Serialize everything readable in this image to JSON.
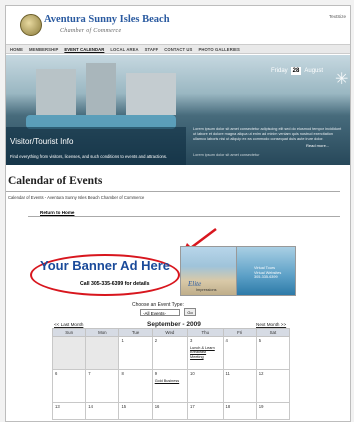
{
  "header": {
    "logo_title": "Aventura Sunny Isles Beach",
    "logo_subtitle": "Chamber of Commerce",
    "text_size_label": "TextSize"
  },
  "nav": [
    {
      "label": "HOME",
      "active": false
    },
    {
      "label": "MEMBERSHIP",
      "active": false
    },
    {
      "label": "EVENT CALENDAR",
      "active": true
    },
    {
      "label": "LOCAL AREA",
      "active": false
    },
    {
      "label": "STAFF",
      "active": false
    },
    {
      "label": "CONTACT US",
      "active": false
    },
    {
      "label": "PHOTO GALLERIES",
      "active": false
    }
  ],
  "hero": {
    "title": "Visitor/Tourist Info",
    "subtitle": "Find everything from visitors, licenses, and such conditions to events and attractions.",
    "day_name": "Friday",
    "day_number": "28",
    "month": "August",
    "news_text": "Lorem ipsum dolor sit amet consectetur adipiscing elit sed do eiusmod tempor incididunt ut labore et dolore magna aliqua ut enim ad minim veniam quis nostrud exercitation ullamco laboris nisi ut aliquip ex ea commodo consequat duis aute irure dolor.",
    "read_more": "Read more...",
    "news_footer": "Lorem ipsum dolor sit amet consectetur"
  },
  "page": {
    "heading": "Calendar of Events",
    "breadcrumb": "Calendar of Events - Aventura Sunny Isles Beach Chamber of Commerce",
    "back_link": "Return to Home"
  },
  "banner_ad": {
    "title": "Your Banner Ad Here",
    "subtitle": "Call 305-335-6399 for details",
    "outline_color": "#d8161e",
    "arrow_color": "#d8161e"
  },
  "side_ad": {
    "brand": "Elite",
    "brand_sub": "Impressions",
    "tours_text": "Virtual Tours\nVirtual Websites\n305-335-6399"
  },
  "event_filter": {
    "label": "Choose an Event Type:",
    "selected": "-All Events-",
    "button": "Go"
  },
  "calendar": {
    "prev_label": "<< Last Month",
    "next_label": "Next Month >>",
    "title": "September - 2009",
    "weekdays": [
      "Sun",
      "Mon",
      "Tue",
      "Wed",
      "Thu",
      "Fri",
      "Sat"
    ],
    "weeks": [
      [
        {
          "day": "",
          "empty": true
        },
        {
          "day": "",
          "empty": true
        },
        {
          "day": "1"
        },
        {
          "day": "2"
        },
        {
          "day": "3",
          "event": "Lunch & Learn Breakfast Meeting"
        },
        {
          "day": "4"
        },
        {
          "day": "5"
        }
      ],
      [
        {
          "day": "6"
        },
        {
          "day": "7"
        },
        {
          "day": "8"
        },
        {
          "day": "9",
          "event": "Gold Business"
        },
        {
          "day": "10"
        },
        {
          "day": "11"
        },
        {
          "day": "12"
        }
      ],
      [
        {
          "day": "13"
        },
        {
          "day": "14"
        },
        {
          "day": "15"
        },
        {
          "day": "16"
        },
        {
          "day": "17"
        },
        {
          "day": "18"
        },
        {
          "day": "19"
        }
      ]
    ]
  }
}
